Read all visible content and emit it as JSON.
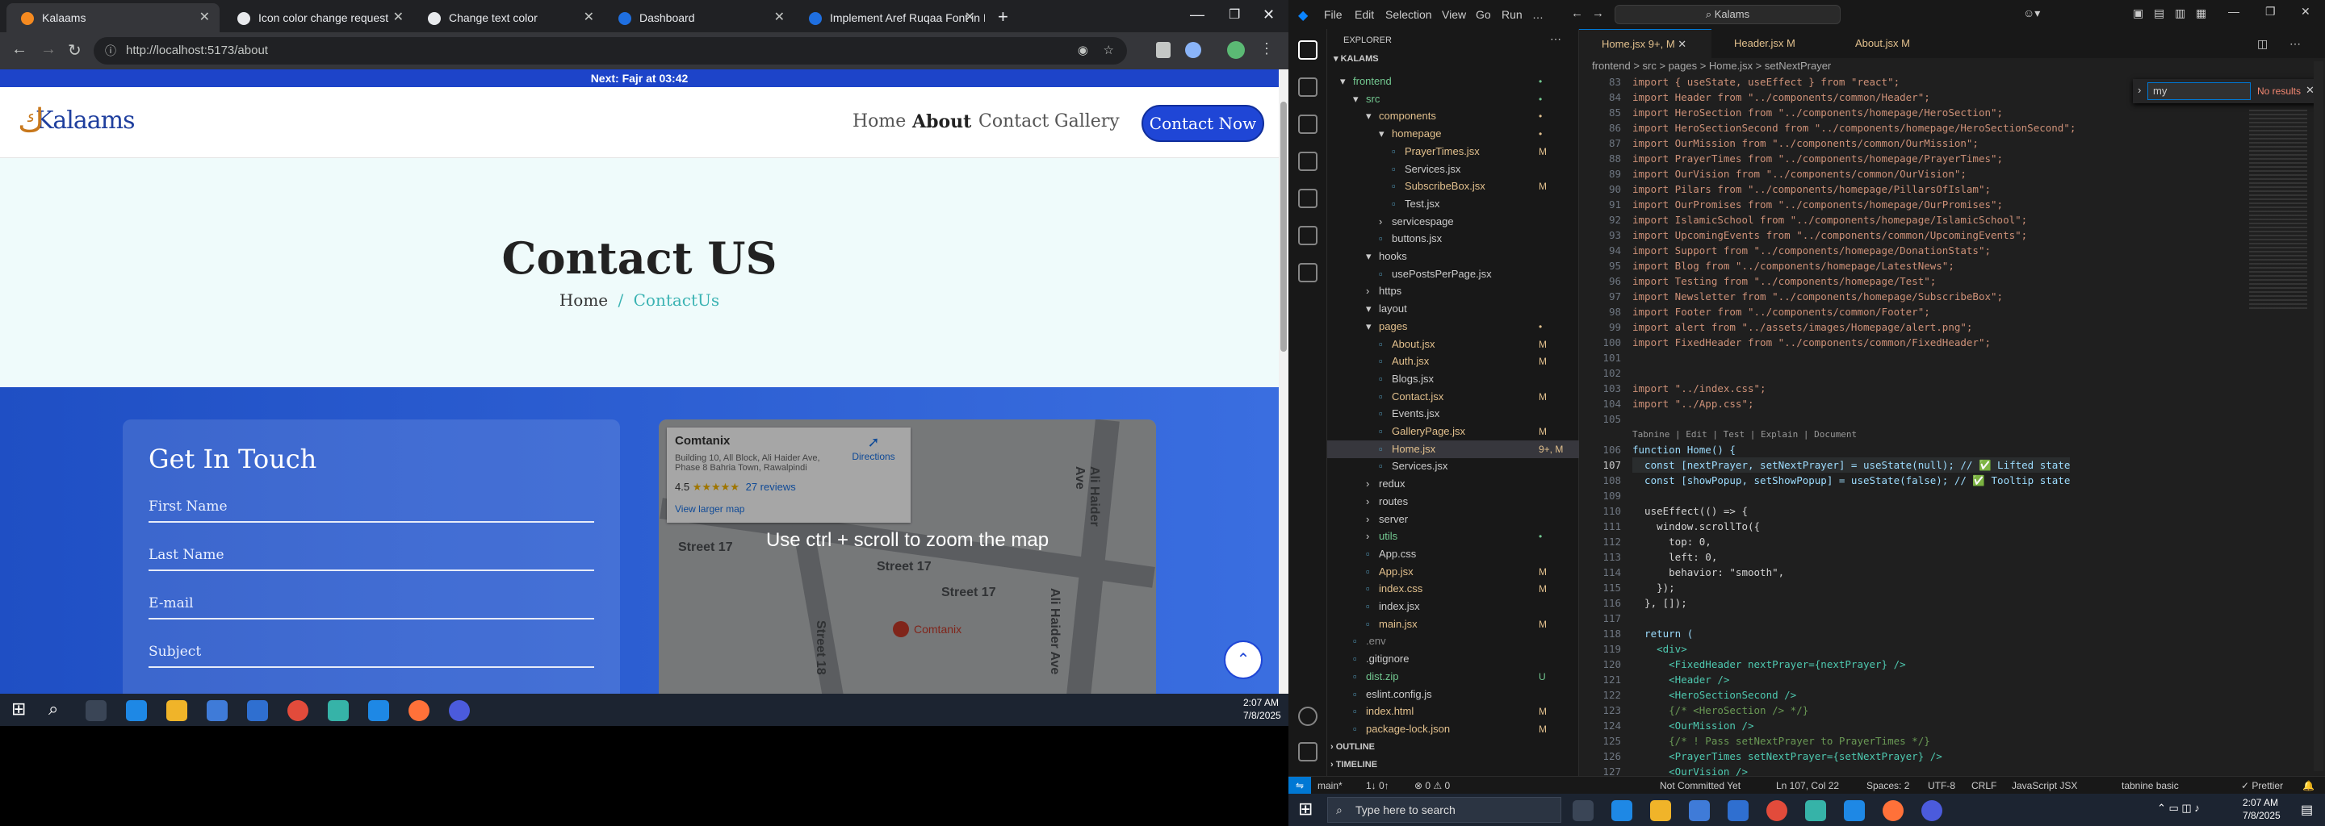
{
  "browser": {
    "tabs": [
      {
        "label": "Kalaams",
        "color": "#f58a20"
      },
      {
        "label": "Icon color change request",
        "color": "#e8eaed"
      },
      {
        "label": "Change text color",
        "color": "#e8eaed"
      },
      {
        "label": "Dashboard",
        "color": "#1f6fe0"
      },
      {
        "label": "Implement Aref Ruqaa Font in I",
        "color": "#1f6fe0"
      }
    ],
    "url": "http://localhost:5173/about",
    "new_tab": "+"
  },
  "site": {
    "top_notice": "Next: Fajr at 03:42",
    "logo": "Kalaams",
    "nav": [
      "Home",
      "About",
      "Contact",
      "Gallery"
    ],
    "cta": "Contact Now",
    "hero_title": "Contact US",
    "crumb_home": "Home",
    "crumb_sep": "/",
    "crumb_current": "ContactUs",
    "form_title": "Get In Touch",
    "fields": [
      "First Name",
      "Last Name",
      "E-mail",
      "Subject"
    ],
    "map": {
      "place": "Comtanix",
      "address": "Building 10, All Block, Ali Haider Ave, Phase 8 Bahria Town, Rawalpindi",
      "rating": "4.5",
      "stars": "★★★★★",
      "reviews": "27 reviews",
      "directions": "Directions",
      "larger": "View larger map",
      "streets": [
        "Street 17",
        "Street 17",
        "Street 17",
        "Ali Haider Ave",
        "Ali Haider Ave",
        "Street 18"
      ],
      "pin": "Comtanix",
      "zoom_tip": "Use ctrl + scroll to zoom the map"
    }
  },
  "taskbar_left": {
    "time": "2:07 AM",
    "date": "7/8/2025"
  },
  "vscode": {
    "menu": [
      "File",
      "Edit",
      "Selection",
      "View",
      "Go",
      "Run",
      "…"
    ],
    "search": "Kalams",
    "explorer_title": "EXPLORER",
    "root": "KALAMS",
    "tree": [
      {
        "name": "frontend",
        "indent": 0,
        "kind": "open",
        "color": "#73c991",
        "status": "•"
      },
      {
        "name": "src",
        "indent": 1,
        "kind": "open",
        "color": "#73c991",
        "status": "•"
      },
      {
        "name": "components",
        "indent": 2,
        "kind": "open",
        "color": "#e2c08d",
        "status": "•"
      },
      {
        "name": "homepage",
        "indent": 3,
        "kind": "open",
        "color": "#e2c08d",
        "status": "•"
      },
      {
        "name": "PrayerTimes.jsx",
        "indent": 4,
        "kind": "file",
        "color": "#e2c08d",
        "status": "M"
      },
      {
        "name": "Services.jsx",
        "indent": 4,
        "kind": "file",
        "color": "#cccccc",
        "status": ""
      },
      {
        "name": "SubscribeBox.jsx",
        "indent": 4,
        "kind": "file",
        "color": "#e2c08d",
        "status": "M"
      },
      {
        "name": "Test.jsx",
        "indent": 4,
        "kind": "file",
        "color": "#cccccc",
        "status": ""
      },
      {
        "name": "servicespage",
        "indent": 3,
        "kind": "closed",
        "color": "#cccccc",
        "status": ""
      },
      {
        "name": "buttons.jsx",
        "indent": 3,
        "kind": "file",
        "color": "#cccccc",
        "status": ""
      },
      {
        "name": "hooks",
        "indent": 2,
        "kind": "open",
        "color": "#cccccc",
        "status": ""
      },
      {
        "name": "usePostsPerPage.jsx",
        "indent": 3,
        "kind": "file",
        "color": "#cccccc",
        "status": ""
      },
      {
        "name": "https",
        "indent": 2,
        "kind": "closed",
        "color": "#cccccc",
        "status": ""
      },
      {
        "name": "layout",
        "indent": 2,
        "kind": "open",
        "color": "#cccccc",
        "status": ""
      },
      {
        "name": "pages",
        "indent": 2,
        "kind": "open",
        "color": "#e2c08d",
        "status": "•"
      },
      {
        "name": "About.jsx",
        "indent": 3,
        "kind": "file",
        "color": "#e2c08d",
        "status": "M"
      },
      {
        "name": "Auth.jsx",
        "indent": 3,
        "kind": "file",
        "color": "#e2c08d",
        "status": "M"
      },
      {
        "name": "Blogs.jsx",
        "indent": 3,
        "kind": "file",
        "color": "#cccccc",
        "status": ""
      },
      {
        "name": "Contact.jsx",
        "indent": 3,
        "kind": "file",
        "color": "#e2c08d",
        "status": "M"
      },
      {
        "name": "Events.jsx",
        "indent": 3,
        "kind": "file",
        "color": "#cccccc",
        "status": ""
      },
      {
        "name": "GalleryPage.jsx",
        "indent": 3,
        "kind": "file",
        "color": "#e2c08d",
        "status": "M"
      },
      {
        "name": "Home.jsx",
        "indent": 3,
        "kind": "file",
        "color": "#e2c08d",
        "status": "9+, M",
        "sel": true
      },
      {
        "name": "Services.jsx",
        "indent": 3,
        "kind": "file",
        "color": "#cccccc",
        "status": ""
      },
      {
        "name": "redux",
        "indent": 2,
        "kind": "closed",
        "color": "#cccccc",
        "status": ""
      },
      {
        "name": "routes",
        "indent": 2,
        "kind": "closed",
        "color": "#cccccc",
        "status": ""
      },
      {
        "name": "server",
        "indent": 2,
        "kind": "closed",
        "color": "#cccccc",
        "status": ""
      },
      {
        "name": "utils",
        "indent": 2,
        "kind": "closed",
        "color": "#73c991",
        "status": "•"
      },
      {
        "name": "App.css",
        "indent": 2,
        "kind": "file",
        "color": "#cccccc",
        "status": ""
      },
      {
        "name": "App.jsx",
        "indent": 2,
        "kind": "file",
        "color": "#e2c08d",
        "status": "M"
      },
      {
        "name": "index.css",
        "indent": 2,
        "kind": "file",
        "color": "#e2c08d",
        "status": "M"
      },
      {
        "name": "index.jsx",
        "indent": 2,
        "kind": "file",
        "color": "#cccccc",
        "status": ""
      },
      {
        "name": "main.jsx",
        "indent": 2,
        "kind": "file",
        "color": "#e2c08d",
        "status": "M"
      },
      {
        "name": ".env",
        "indent": 1,
        "kind": "file",
        "color": "#8b8b8b",
        "status": ""
      },
      {
        "name": ".gitignore",
        "indent": 1,
        "kind": "file",
        "color": "#cccccc",
        "status": ""
      },
      {
        "name": "dist.zip",
        "indent": 1,
        "kind": "file",
        "color": "#73c991",
        "status": "U"
      },
      {
        "name": "eslint.config.js",
        "indent": 1,
        "kind": "file",
        "color": "#cccccc",
        "status": ""
      },
      {
        "name": "index.html",
        "indent": 1,
        "kind": "file",
        "color": "#e2c08d",
        "status": "M"
      },
      {
        "name": "package-lock.json",
        "indent": 1,
        "kind": "file",
        "color": "#e2c08d",
        "status": "M"
      }
    ],
    "outline": "OUTLINE",
    "timeline": "TIMELINE",
    "tabs": [
      "Home.jsx 9+, M",
      "Header.jsx M",
      "About.jsx M"
    ],
    "breadcrumb": "frontend > src > pages > Home.jsx > setNextPrayer",
    "find": {
      "value": "my",
      "results": "No results"
    },
    "codelens": "Tabnine | Edit | Test | Explain | Document",
    "code": [
      {
        "n": "83",
        "t": "import { useState, useEffect } from \"react\";"
      },
      {
        "n": "84",
        "t": "import Header from \"../components/common/Header\";"
      },
      {
        "n": "85",
        "t": "import HeroSection from \"../components/homepage/HeroSection\";"
      },
      {
        "n": "86",
        "t": "import HeroSectionSecond from \"../components/homepage/HeroSectionSecond\";"
      },
      {
        "n": "87",
        "t": "import OurMission from \"../components/common/OurMission\";"
      },
      {
        "n": "88",
        "t": "import PrayerTimes from \"../components/homepage/PrayerTimes\";"
      },
      {
        "n": "89",
        "t": "import OurVision from \"../components/common/OurVision\";"
      },
      {
        "n": "90",
        "t": "import Pilars from \"../components/homepage/PillarsOfIslam\";"
      },
      {
        "n": "91",
        "t": "import OurPromises from \"../components/homepage/OurPromises\";"
      },
      {
        "n": "92",
        "t": "import IslamicSchool from \"../components/homepage/IslamicSchool\";"
      },
      {
        "n": "93",
        "t": "import UpcomingEvents from \"../components/common/UpcomingEvents\";"
      },
      {
        "n": "94",
        "t": "import Support from \"../components/homepage/DonationStats\";"
      },
      {
        "n": "95",
        "t": "import Blog from \"../components/homepage/LatestNews\";"
      },
      {
        "n": "96",
        "t": "import Testing from \"../components/homepage/Test\";"
      },
      {
        "n": "97",
        "t": "import Newsletter from \"../components/homepage/SubscribeBox\";"
      },
      {
        "n": "98",
        "t": "import Footer from \"../components/common/Footer\";"
      },
      {
        "n": "99",
        "t": "import alert from \"../assets/images/Homepage/alert.png\";"
      },
      {
        "n": "100",
        "t": "import FixedHeader from \"../components/common/FixedHeader\";"
      },
      {
        "n": "101",
        "t": ""
      },
      {
        "n": "102",
        "t": ""
      },
      {
        "n": "103",
        "t": "import \"../index.css\";"
      },
      {
        "n": "104",
        "t": "import \"../App.css\";"
      },
      {
        "n": "105",
        "t": ""
      },
      {
        "n": "106",
        "t": "function Home() {"
      },
      {
        "n": "107",
        "t": "  const [nextPrayer, setNextPrayer] = useState(null); // ✅ Lifted state"
      },
      {
        "n": "108",
        "t": "  const [showPopup, setShowPopup] = useState(false); // ✅ Tooltip state"
      },
      {
        "n": "109",
        "t": ""
      },
      {
        "n": "110",
        "t": "  useEffect(() => {"
      },
      {
        "n": "111",
        "t": "    window.scrollTo({"
      },
      {
        "n": "112",
        "t": "      top: 0,"
      },
      {
        "n": "113",
        "t": "      left: 0,"
      },
      {
        "n": "114",
        "t": "      behavior: \"smooth\","
      },
      {
        "n": "115",
        "t": "    });"
      },
      {
        "n": "116",
        "t": "  }, []);"
      },
      {
        "n": "117",
        "t": ""
      },
      {
        "n": "118",
        "t": "  return ("
      },
      {
        "n": "119",
        "t": "    <div>"
      },
      {
        "n": "120",
        "t": "      <FixedHeader nextPrayer={nextPrayer} />"
      },
      {
        "n": "121",
        "t": "      <Header />"
      },
      {
        "n": "122",
        "t": "      <HeroSectionSecond />"
      },
      {
        "n": "123",
        "t": "      {/* <HeroSection /> */}"
      },
      {
        "n": "124",
        "t": "      <OurMission />"
      },
      {
        "n": "125",
        "t": "      {/* ! Pass setNextPrayer to PrayerTimes */}"
      },
      {
        "n": "126",
        "t": "      <PrayerTimes setNextPrayer={setNextPrayer} />"
      },
      {
        "n": "127",
        "t": "      <OurVision />"
      }
    ],
    "status": {
      "branch": "main*",
      "sync": "1↓ 0↑",
      "problems": "⊗ 0 ⚠ 0",
      "committed": "Not Committed Yet",
      "position": "Ln 107, Col 22",
      "spaces": "Spaces: 2",
      "encoding": "UTF-8",
      "eol": "CRLF",
      "language": "JavaScript JSX",
      "tabnine": "tabnine basic",
      "prettier": "✓ Prettier"
    }
  },
  "taskbar_right": {
    "search": "Type here to search",
    "time": "2:07 AM",
    "date": "7/8/2025"
  }
}
